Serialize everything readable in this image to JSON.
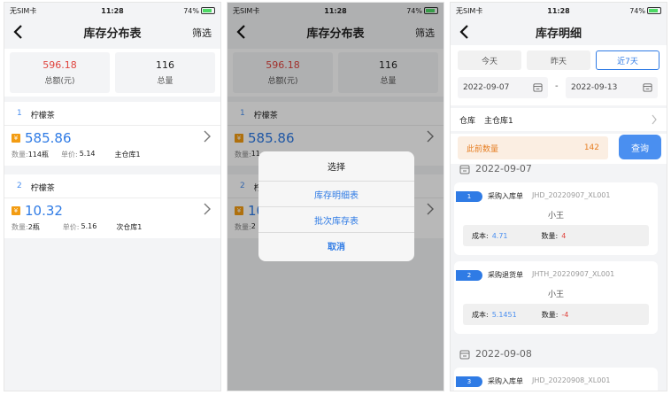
{
  "status": {
    "carrier": "无SIM卡",
    "time": "11:28",
    "battery": "74%"
  },
  "inventory": {
    "title": "库存分布表",
    "filter_label": "筛选",
    "total_amount": "596.18",
    "total_amount_label": "总额(元)",
    "total_qty": "116",
    "total_qty_label": "总量",
    "items": [
      {
        "index": "1",
        "name": "柠檬茶",
        "amount": "585.86",
        "qty_label": "数量:",
        "qty": "114瓶",
        "price_label": "单价:",
        "price": "5.14",
        "warehouse": "主仓库1"
      },
      {
        "index": "2",
        "name": "柠檬茶",
        "amount": "10.32",
        "qty_label": "数量:",
        "qty": "2瓶",
        "price_label": "单价:",
        "price": "5.16",
        "warehouse": "次仓库1"
      }
    ],
    "partial_items": [
      {
        "index": "1",
        "name": "柠檬茶",
        "amount": "585.86",
        "qty_label": "数量:",
        "qty": "11"
      },
      {
        "index": "2",
        "name": "柠",
        "amount": "10",
        "qty_label": "数量:",
        "qty": "2"
      }
    ]
  },
  "dialog": {
    "title": "选择",
    "options": [
      "库存明细表",
      "批次库存表",
      "取消"
    ]
  },
  "detail": {
    "title": "库存明细",
    "segments": [
      "今天",
      "昨天",
      "近7天"
    ],
    "active_segment": "近7天",
    "start_date": "2022-09-07",
    "end_date": "2022-09-13",
    "date_separator": "-",
    "warehouse_label": "仓库",
    "warehouse_value": "主仓库1",
    "prev_qty_label": "此前数量",
    "prev_qty": "142",
    "query_label": "查询",
    "groups": [
      {
        "date": "2022-09-07"
      },
      {
        "date": "2022-09-08"
      }
    ],
    "records": [
      {
        "index": "1",
        "type": "采购入库单",
        "no": "JHD_20220907_XL001",
        "person": "小王",
        "cost_label": "成本:",
        "cost": "4.71",
        "qty_label": "数量:",
        "qty": "4"
      },
      {
        "index": "2",
        "type": "采购退货单",
        "no": "JHTH_20220907_XL001",
        "person": "小王",
        "cost_label": "成本:",
        "cost": "5.1451",
        "qty_label": "数量:",
        "qty": "-4"
      },
      {
        "index": "3",
        "type": "采购入库单",
        "no": "JHD_20220908_XL001"
      }
    ]
  },
  "colors": {
    "accent": "#2f7be5",
    "red": "#e0443e",
    "orange": "#e67e22"
  }
}
